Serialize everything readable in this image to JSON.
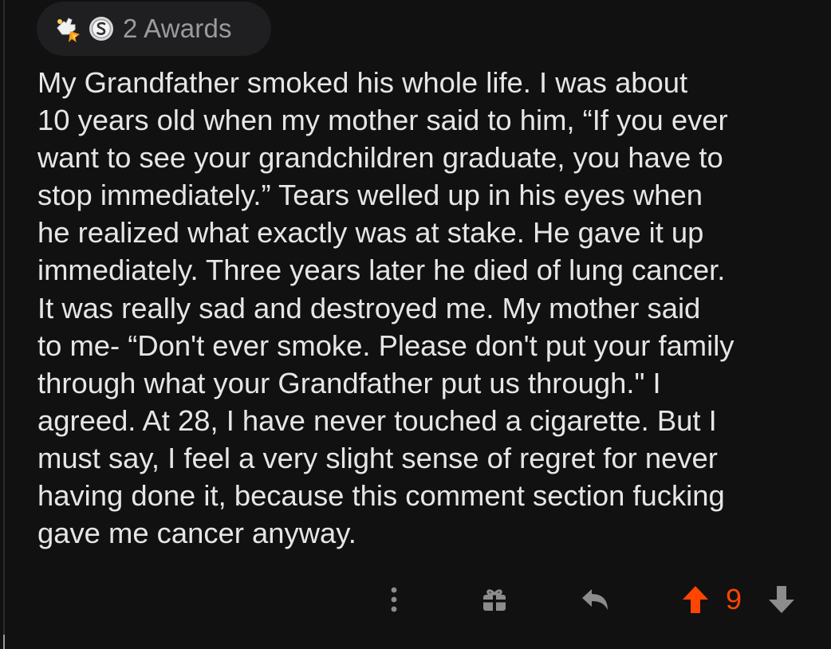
{
  "awards": {
    "label": "2 Awards",
    "icons": [
      "rocket-like-award-icon",
      "silver-award-icon"
    ]
  },
  "comment": {
    "lines": [
      "My Grandfather smoked his whole life. I was about",
      "10 years old when my mother said to him, “If you ever",
      "want to see your grandchildren graduate, you have to",
      "stop immediately.” Tears welled up in his eyes when",
      "he realized what exactly was at stake. He gave it up",
      "immediately. Three years later he died of lung cancer.",
      "It was really sad and destroyed me. My mother said",
      "to me- “Don't ever smoke. Please don't put your family",
      "through what your Grandfather put us through.\" I",
      "agreed. At 28, I have never touched a cigarette. But I",
      "must say, I feel a very slight sense of regret for never",
      "having done it, because this comment section fucking",
      "gave me cancer anyway."
    ]
  },
  "actions": {
    "more_icon": "more-vertical-icon",
    "gift_icon": "gift-icon",
    "reply_icon": "reply-icon",
    "upvote_icon": "upvote-arrow-icon",
    "score": "9",
    "downvote_icon": "downvote-arrow-icon"
  },
  "colors": {
    "background": "#111112",
    "text": "#e6e6e6",
    "muted": "#9b9b9b",
    "upvote_accent": "#ff4500",
    "pill": "#1f1f21"
  }
}
